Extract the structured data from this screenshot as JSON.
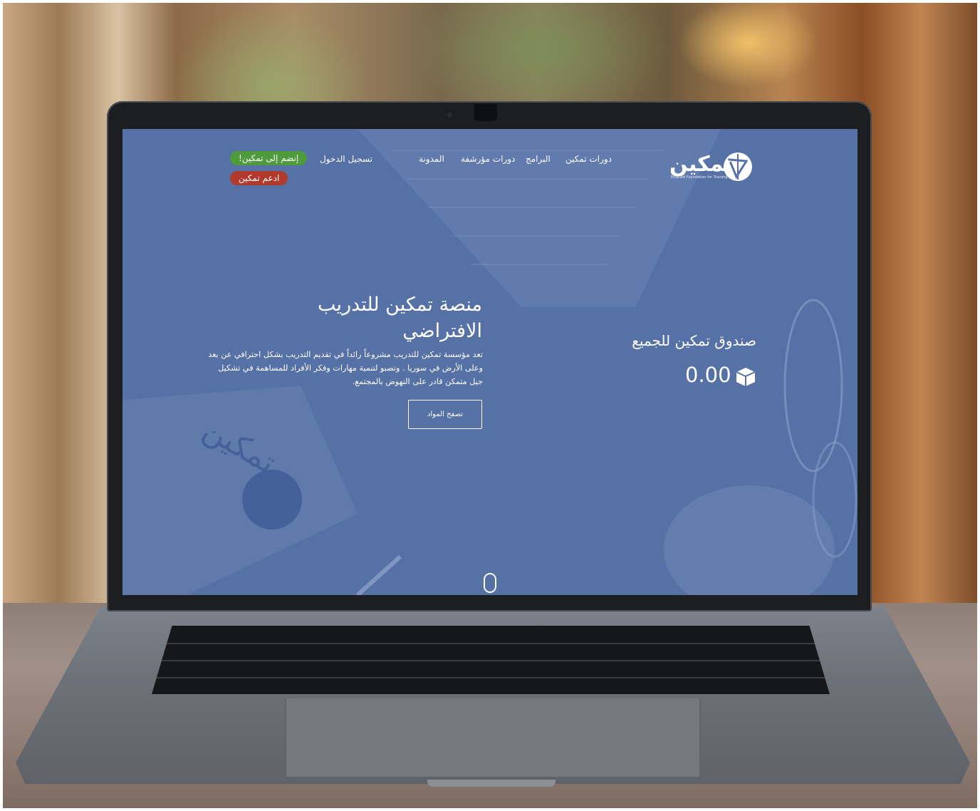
{
  "nav": {
    "logo_text": "تمكين",
    "logo_sub": "Enabled Foundation for Training",
    "links": [
      "دورات تمكين",
      "البرامج",
      "دورات مؤرشفة",
      "المدونة",
      "تسجيل الدخول"
    ],
    "join_button": "إنضم إلى تمكين!",
    "support_button": "ادعم تمكين"
  },
  "hero": {
    "title_line1": "منصة تمكين للتدريب",
    "title_line2": "الافتراضي",
    "body": "تعد مؤسسة تمكين للتدريب مشروعاً رائداً في تقديم التدريب بشكل احترافي عن بعد وعلى الأرض في سوريا . وتصبو لتنمية مهارات وفكر الأفراد للمساهمة في تشكيل جيل متمكن قادر على النهوض بالمجتمع.",
    "browse_button": "تصفح المواد"
  },
  "fund": {
    "title": "صندوق تمكين للجميع",
    "amount": "0.00",
    "icon": "box-icon"
  },
  "colors": {
    "screen_overlay": "#5671a6",
    "join_green": "#4e9a3c",
    "support_red": "#b23a2c"
  }
}
